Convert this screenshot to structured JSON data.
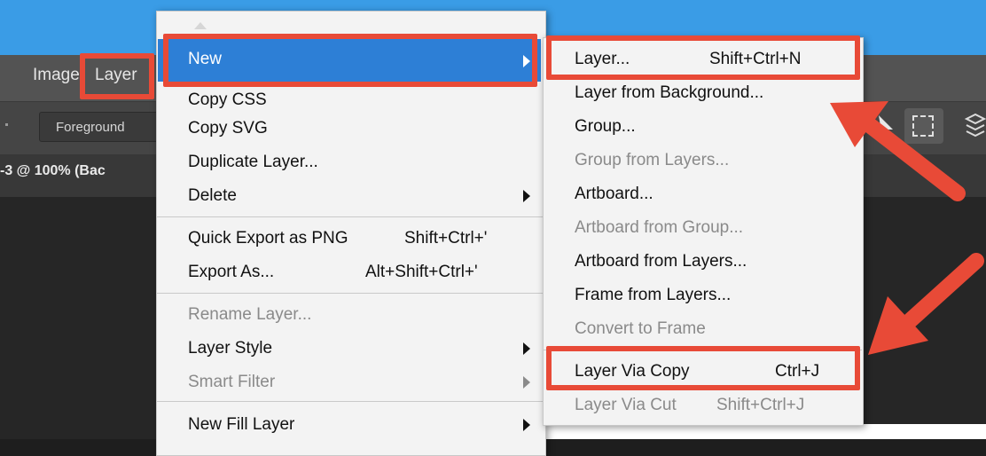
{
  "menubar": {
    "image_label": "Image",
    "layer_label": "Layer"
  },
  "options_bar": {
    "foreground_label": "Foreground"
  },
  "document_tab": {
    "title": "-3 @ 100% (Bac"
  },
  "layer_menu": {
    "items": [
      {
        "label": "New",
        "has_submenu": true,
        "highlighted": true
      },
      {
        "label": "Copy CSS"
      },
      {
        "label": "Copy SVG"
      },
      {
        "label": "Duplicate Layer..."
      },
      {
        "label": "Delete",
        "has_submenu": true
      },
      {
        "label": "Quick Export as PNG",
        "shortcut": "Shift+Ctrl+'"
      },
      {
        "label": "Export As...",
        "shortcut": "Alt+Shift+Ctrl+'"
      },
      {
        "label": "Rename Layer...",
        "disabled": true
      },
      {
        "label": "Layer Style",
        "has_submenu": true
      },
      {
        "label": "Smart Filter",
        "disabled": true,
        "has_submenu": true
      },
      {
        "label": "New Fill Layer",
        "has_submenu": true
      }
    ]
  },
  "new_submenu": {
    "items": [
      {
        "label": "Layer...",
        "shortcut": "Shift+Ctrl+N"
      },
      {
        "label": "Layer from Background..."
      },
      {
        "label": "Group..."
      },
      {
        "label": "Group from Layers...",
        "disabled": true
      },
      {
        "label": "Artboard..."
      },
      {
        "label": "Artboard from Group...",
        "disabled": true
      },
      {
        "label": "Artboard from Layers..."
      },
      {
        "label": "Frame from Layers..."
      },
      {
        "label": "Convert to Frame",
        "disabled": true
      },
      {
        "label": "Layer Via Copy",
        "shortcut": "Ctrl+J"
      },
      {
        "label": "Layer Via Cut",
        "shortcut": "Shift+Ctrl+J",
        "disabled": true
      }
    ]
  },
  "annotations": {
    "highlight_color": "#e84a37",
    "menu_highlight_color": "#2d7fd6"
  }
}
